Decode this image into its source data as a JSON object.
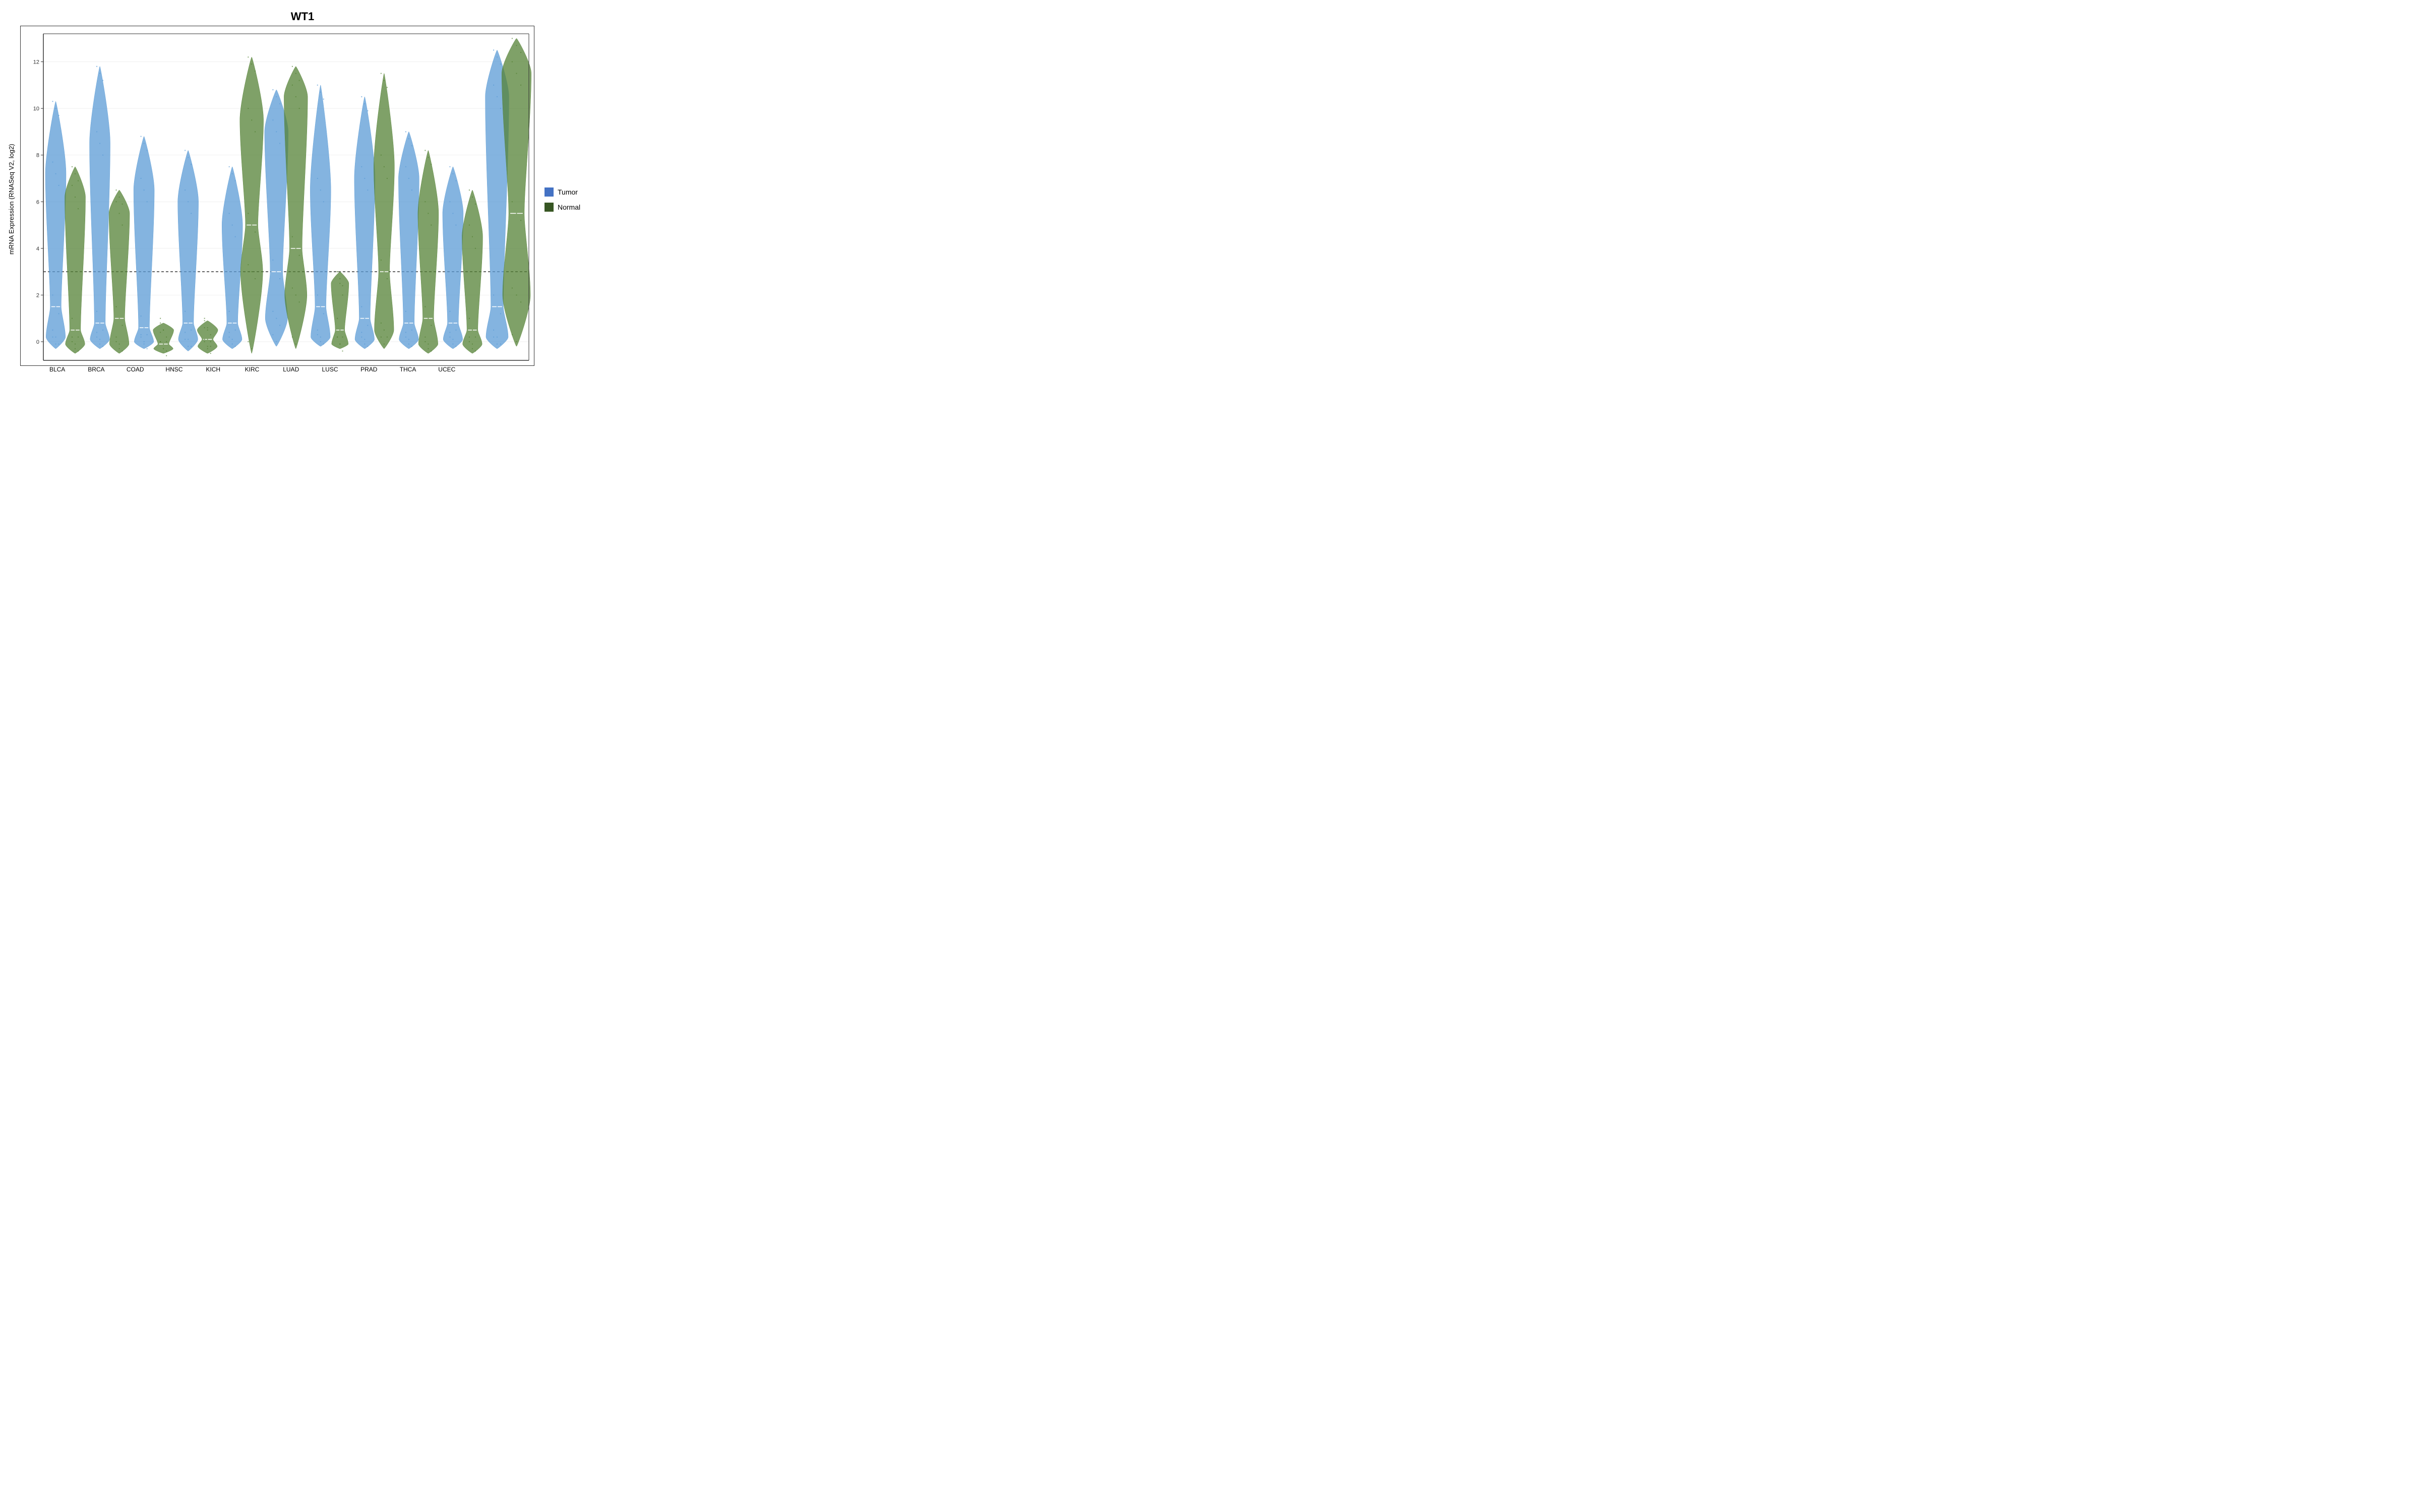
{
  "title": "WT1",
  "y_axis_label": "mRNA Expression (RNASeq V2, log2)",
  "legend": {
    "items": [
      {
        "label": "Tumor",
        "color": "#4472C4"
      },
      {
        "label": "Normal",
        "color": "#375623"
      }
    ]
  },
  "x_labels": [
    "BLCA",
    "BRCA",
    "COAD",
    "HNSC",
    "KICH",
    "KIRC",
    "LUAD",
    "LUSC",
    "PRAD",
    "THCA",
    "UCEC"
  ],
  "y_ticks": [
    0,
    2,
    4,
    6,
    8,
    10,
    12
  ],
  "dotted_line_y": 3,
  "colors": {
    "tumor": "#5B9BD5",
    "normal": "#548235"
  },
  "violins": [
    {
      "id": "BLCA",
      "tumor": {
        "max": 10.3,
        "q3": 7.2,
        "median": 1.5,
        "q1": 0.2,
        "min": -0.3,
        "width": 0.35
      },
      "normal": {
        "max": 7.5,
        "q3": 6.2,
        "median": 0.5,
        "q1": -0.1,
        "min": -0.5,
        "width": 0.35
      }
    },
    {
      "id": "BRCA",
      "tumor": {
        "max": 11.8,
        "q3": 8.5,
        "median": 0.8,
        "q1": 0.1,
        "min": -0.3,
        "width": 0.35
      },
      "normal": {
        "max": 6.5,
        "q3": 5.5,
        "median": 1.0,
        "q1": -0.1,
        "min": -0.5,
        "width": 0.35
      }
    },
    {
      "id": "COAD",
      "tumor": {
        "max": 8.8,
        "q3": 6.5,
        "median": 0.6,
        "q1": 0.0,
        "min": -0.3,
        "width": 0.35
      },
      "normal": {
        "max": 0.8,
        "q3": 0.5,
        "median": -0.1,
        "q1": -0.3,
        "min": -0.5,
        "width": 0.35
      }
    },
    {
      "id": "HNSC",
      "tumor": {
        "max": 8.2,
        "q3": 6.0,
        "median": 0.8,
        "q1": 0.1,
        "min": -0.4,
        "width": 0.35
      },
      "normal": {
        "max": 0.9,
        "q3": 0.5,
        "median": 0.1,
        "q1": -0.2,
        "min": -0.5,
        "width": 0.35
      }
    },
    {
      "id": "KICH",
      "tumor": {
        "max": 7.5,
        "q3": 5.0,
        "median": 0.8,
        "q1": 0.1,
        "min": -0.3,
        "width": 0.35
      },
      "normal": {
        "max": 12.2,
        "q3": 9.5,
        "median": 5.0,
        "q1": 3.0,
        "min": -0.5,
        "width": 0.4
      }
    },
    {
      "id": "KIRC",
      "tumor": {
        "max": 10.8,
        "q3": 9.0,
        "median": 3.0,
        "q1": 1.0,
        "min": -0.2,
        "width": 0.4
      },
      "normal": {
        "max": 11.8,
        "q3": 10.5,
        "median": 4.0,
        "q1": 2.0,
        "min": -0.3,
        "width": 0.4
      }
    },
    {
      "id": "LUAD",
      "tumor": {
        "max": 11.0,
        "q3": 6.5,
        "median": 1.5,
        "q1": 0.2,
        "min": -0.2,
        "width": 0.35
      },
      "normal": {
        "max": 3.0,
        "q3": 2.5,
        "median": 0.5,
        "q1": -0.1,
        "min": -0.3,
        "width": 0.3
      }
    },
    {
      "id": "LUSC",
      "tumor": {
        "max": 10.5,
        "q3": 7.0,
        "median": 1.0,
        "q1": 0.1,
        "min": -0.3,
        "width": 0.35
      },
      "normal": {
        "max": 11.5,
        "q3": 7.5,
        "median": 3.0,
        "q1": 0.5,
        "min": -0.3,
        "width": 0.35
      }
    },
    {
      "id": "PRAD",
      "tumor": {
        "max": 9.0,
        "q3": 7.0,
        "median": 0.8,
        "q1": 0.1,
        "min": -0.3,
        "width": 0.35
      },
      "normal": {
        "max": 8.2,
        "q3": 5.5,
        "median": 1.0,
        "q1": -0.1,
        "min": -0.5,
        "width": 0.35
      }
    },
    {
      "id": "THCA",
      "tumor": {
        "max": 7.5,
        "q3": 5.5,
        "median": 0.8,
        "q1": 0.1,
        "min": -0.3,
        "width": 0.35
      },
      "normal": {
        "max": 6.5,
        "q3": 4.5,
        "median": 0.5,
        "q1": -0.1,
        "min": -0.5,
        "width": 0.35
      }
    },
    {
      "id": "UCEC",
      "tumor": {
        "max": 12.5,
        "q3": 10.5,
        "median": 1.5,
        "q1": 0.2,
        "min": -0.3,
        "width": 0.4
      },
      "normal": {
        "max": 13.0,
        "q3": 11.5,
        "median": 5.5,
        "q1": 2.0,
        "min": -0.2,
        "width": 0.5
      }
    }
  ]
}
